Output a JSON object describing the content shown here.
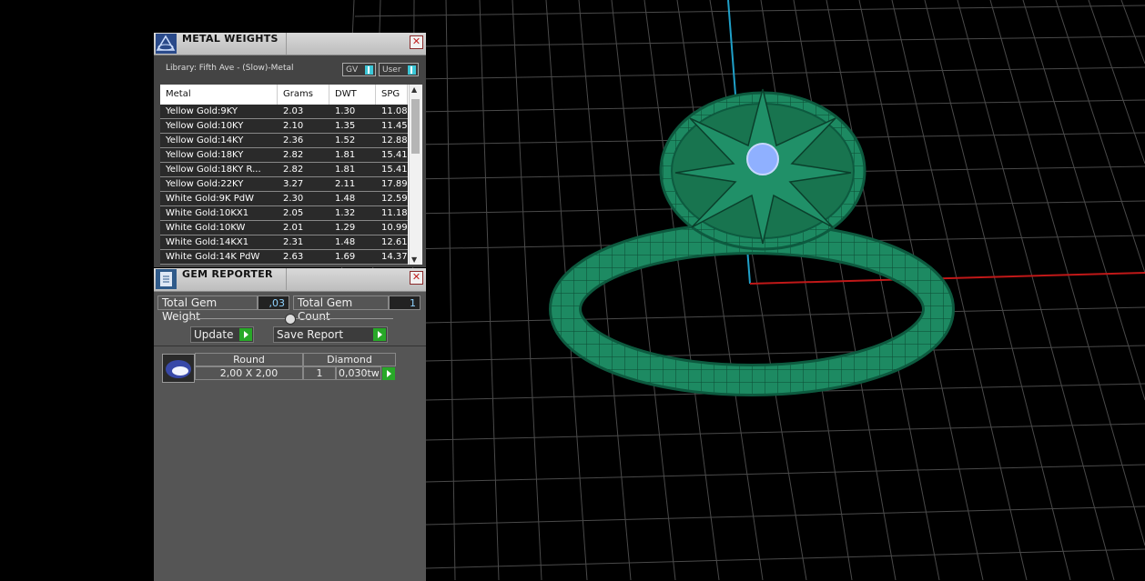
{
  "metal_weights": {
    "title": "METAL WEIGHTS",
    "close_glyph": "✕",
    "library": "Library: Fifth Ave - (Slow)-Metal",
    "toggle_gv": "GV",
    "toggle_user": "User",
    "columns": [
      "Metal",
      "Grams",
      "DWT",
      "SPG"
    ],
    "rows": [
      {
        "metal": "Yellow Gold:9KY",
        "grams": "2.03",
        "dwt": "1.30",
        "spg": "11.08"
      },
      {
        "metal": "Yellow Gold:10KY",
        "grams": "2.10",
        "dwt": "1.35",
        "spg": "11.45"
      },
      {
        "metal": "Yellow Gold:14KY",
        "grams": "2.36",
        "dwt": "1.52",
        "spg": "12.88"
      },
      {
        "metal": "Yellow Gold:18KY",
        "grams": "2.82",
        "dwt": "1.81",
        "spg": "15.41"
      },
      {
        "metal": "Yellow Gold:18KY R...",
        "grams": "2.82",
        "dwt": "1.81",
        "spg": "15.41"
      },
      {
        "metal": "Yellow Gold:22KY",
        "grams": "3.27",
        "dwt": "2.11",
        "spg": "17.89"
      },
      {
        "metal": "White Gold:9K PdW",
        "grams": "2.30",
        "dwt": "1.48",
        "spg": "12.59"
      },
      {
        "metal": "White Gold:10KX1",
        "grams": "2.05",
        "dwt": "1.32",
        "spg": "11.18"
      },
      {
        "metal": "White Gold:10KW",
        "grams": "2.01",
        "dwt": "1.29",
        "spg": "10.99"
      },
      {
        "metal": "White Gold:14KX1",
        "grams": "2.31",
        "dwt": "1.48",
        "spg": "12.61"
      },
      {
        "metal": "White Gold:14K PdW",
        "grams": "2.63",
        "dwt": "1.69",
        "spg": "14.37"
      }
    ]
  },
  "gem_reporter": {
    "title": "GEM REPORTER",
    "close_glyph": "✕",
    "total_weight_label": "Total Gem Weight",
    "total_weight_value": ",03",
    "total_count_label": "Total Gem Count",
    "total_count_value": "1",
    "update_label": "Update",
    "save_label": "Save Report",
    "gem": {
      "shape": "Round",
      "material": "Diamond",
      "size": "2,00 X 2,00",
      "count": "1",
      "weight": "0,030tw"
    }
  },
  "viewport": {
    "model_color": "#1f8a63",
    "grid_color": "#505050",
    "axis_y_color": "#1fa0c8",
    "axis_x_color": "#c01818"
  }
}
